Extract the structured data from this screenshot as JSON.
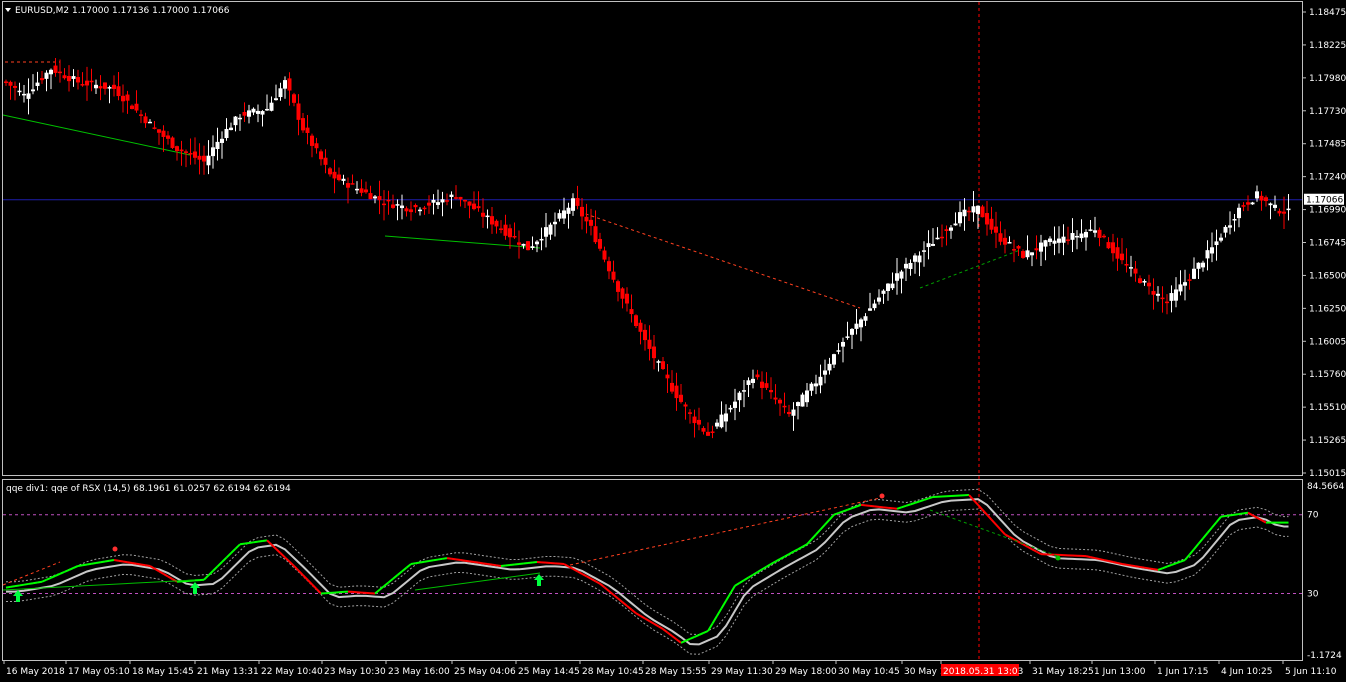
{
  "main_panel": {
    "title": "EURUSD,M2  1.17000 1.17136 1.17000 1.17066",
    "price_labels": [
      "1.18475",
      "1.18225",
      "1.17980",
      "1.17730",
      "1.17485",
      "1.17240",
      "1.16990",
      "1.16745",
      "1.16500",
      "1.16250",
      "1.16005",
      "1.15760",
      "1.15510",
      "1.15265",
      "1.15015"
    ],
    "current_price": "1.17066",
    "bid_line_color": "#1e1eaa",
    "bull_color": "#ffffff",
    "bear_color": "#ff0000"
  },
  "indicator_panel": {
    "title": "qqe div1: qqe of RSX (14,5) 68.1961 61.0257 62.6194 62.6194",
    "labels": [
      "84.5664",
      "70",
      "30",
      "-1.1724"
    ],
    "level_color": "#c050c0",
    "up_color": "#00ff00",
    "down_color": "#ff0000",
    "slow_color": "#c8c8c8"
  },
  "time_axis": {
    "labels": [
      "16 May 2018",
      "17 May 05:10",
      "18 May 15:45",
      "21 May 13:31",
      "22 May 10:40",
      "23 May 10:30",
      "23 May 16:00",
      "25 May 04:06",
      "25 May 14:45",
      "28 May 10:45",
      "28 May 15:55",
      "29 May 11:30",
      "29 May 18:00",
      "30 May 10:45",
      "30 May 1",
      "2018.05.31 13:03",
      "31 May 18:25",
      "1 Jun 13:00",
      "1 Jun 17:15",
      "4 Jun 10:25",
      "5 Jun 11:10"
    ],
    "highlight_color": "#ff0000"
  },
  "chart_data": {
    "type": "candlestick",
    "symbol": "EURUSD",
    "timeframe": "M2",
    "ylim": [
      1.15015,
      1.18475
    ],
    "indicator_ylim": [
      -1.1724,
      84.5664
    ],
    "levels": [
      30,
      70
    ],
    "close_path": [
      [
        0,
        1.1795
      ],
      [
        4,
        1.1785
      ],
      [
        10,
        1.1805
      ],
      [
        16,
        1.1795
      ],
      [
        24,
        1.179
      ],
      [
        33,
        1.176
      ],
      [
        38,
        1.1745
      ],
      [
        44,
        1.1735
      ],
      [
        48,
        1.1755
      ],
      [
        52,
        1.177
      ],
      [
        58,
        1.1775
      ],
      [
        62,
        1.1795
      ],
      [
        66,
        1.176
      ],
      [
        72,
        1.1725
      ],
      [
        78,
        1.1715
      ],
      [
        84,
        1.1705
      ],
      [
        90,
        1.17
      ],
      [
        96,
        1.1705
      ],
      [
        100,
        1.171
      ],
      [
        104,
        1.17
      ],
      [
        110,
        1.1685
      ],
      [
        116,
        1.167
      ],
      [
        122,
        1.169
      ],
      [
        126,
        1.1705
      ],
      [
        130,
        1.1685
      ],
      [
        136,
        1.164
      ],
      [
        142,
        1.16
      ],
      [
        148,
        1.1565
      ],
      [
        152,
        1.1545
      ],
      [
        156,
        1.153
      ],
      [
        162,
        1.1555
      ],
      [
        166,
        1.1575
      ],
      [
        170,
        1.156
      ],
      [
        174,
        1.1545
      ],
      [
        180,
        1.157
      ],
      [
        186,
        1.16
      ],
      [
        192,
        1.1625
      ],
      [
        198,
        1.165
      ],
      [
        206,
        1.1675
      ],
      [
        212,
        1.1695
      ],
      [
        216,
        1.17
      ],
      [
        220,
        1.168
      ],
      [
        226,
        1.1665
      ],
      [
        232,
        1.1675
      ],
      [
        238,
        1.168
      ],
      [
        242,
        1.1685
      ],
      [
        248,
        1.166
      ],
      [
        254,
        1.164
      ],
      [
        258,
        1.163
      ],
      [
        262,
        1.1645
      ],
      [
        268,
        1.167
      ],
      [
        274,
        1.17
      ],
      [
        278,
        1.171
      ],
      [
        282,
        1.17
      ],
      [
        285,
        1.1697
      ]
    ],
    "qqe_fast": [
      [
        0,
        33
      ],
      [
        8,
        36
      ],
      [
        16,
        44
      ],
      [
        24,
        47
      ],
      [
        32,
        44
      ],
      [
        38,
        36
      ],
      [
        44,
        37
      ],
      [
        52,
        55
      ],
      [
        58,
        57
      ],
      [
        64,
        44
      ],
      [
        70,
        30
      ],
      [
        76,
        31
      ],
      [
        82,
        30
      ],
      [
        90,
        45
      ],
      [
        98,
        48
      ],
      [
        104,
        46
      ],
      [
        110,
        44
      ],
      [
        118,
        46
      ],
      [
        124,
        45
      ],
      [
        132,
        35
      ],
      [
        140,
        20
      ],
      [
        146,
        12
      ],
      [
        150,
        5
      ],
      [
        156,
        11
      ],
      [
        162,
        34
      ],
      [
        170,
        45
      ],
      [
        178,
        55
      ],
      [
        184,
        70
      ],
      [
        190,
        75
      ],
      [
        198,
        73
      ],
      [
        206,
        79
      ],
      [
        214,
        80
      ],
      [
        222,
        60
      ],
      [
        230,
        50
      ],
      [
        240,
        49
      ],
      [
        248,
        45
      ],
      [
        256,
        42
      ],
      [
        262,
        47
      ],
      [
        270,
        69
      ],
      [
        276,
        71
      ],
      [
        280,
        66
      ]
    ]
  }
}
